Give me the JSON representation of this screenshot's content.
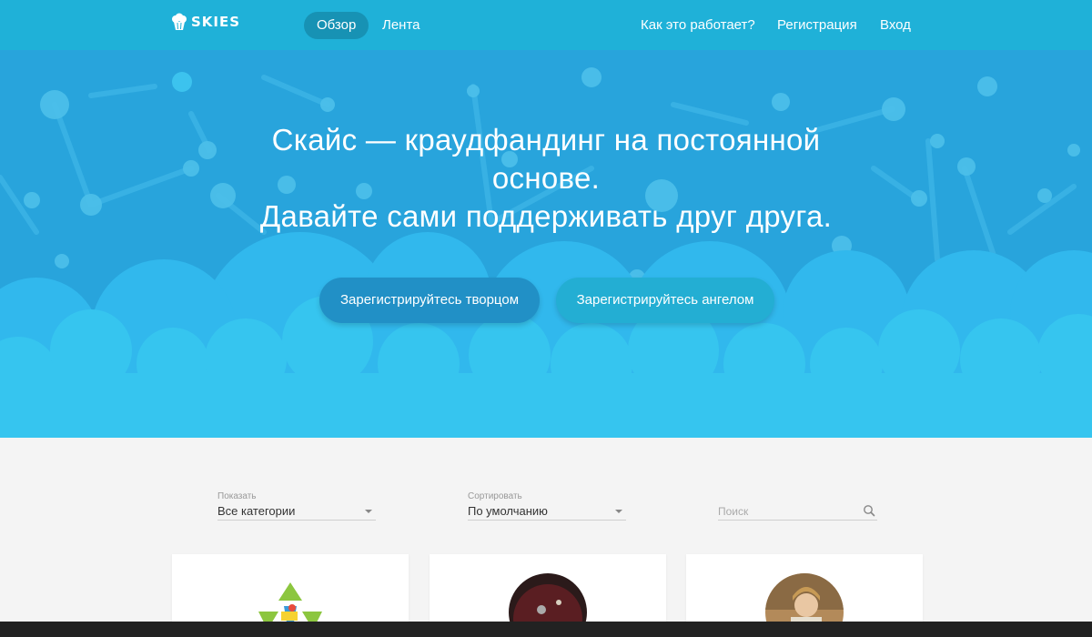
{
  "navbar": {
    "logo_text": "SKIES",
    "links": [
      {
        "label": "Обзор",
        "active": true
      },
      {
        "label": "Лента",
        "active": false
      }
    ],
    "right_links": [
      {
        "label": "Как это работает?"
      },
      {
        "label": "Регистрация"
      },
      {
        "label": "Вход"
      }
    ]
  },
  "hero": {
    "title_line1": "Скайс — краудфандинг на постоянной",
    "title_line2": "основе.",
    "title_line3": "Давайте сами поддерживать друг друга.",
    "btn_creator": "Зарегистрируйтесь творцом",
    "btn_angel": "Зарегистрируйтесь ангелом"
  },
  "filters": {
    "show_label": "Показать",
    "show_value": "Все категории",
    "sort_label": "Сортировать",
    "sort_value": "По умолчанию",
    "search_placeholder": "Поиск"
  },
  "colors": {
    "navbar": "#1fb1d8",
    "hero_bg": "#28a4dc",
    "cloud": "#36c5ef",
    "btn_creator": "#2190c6",
    "btn_angel": "#23aed3"
  },
  "cards": [
    {
      "avatar": "recycle-image"
    },
    {
      "avatar": "dark-photo"
    },
    {
      "avatar": "child-photo"
    }
  ]
}
